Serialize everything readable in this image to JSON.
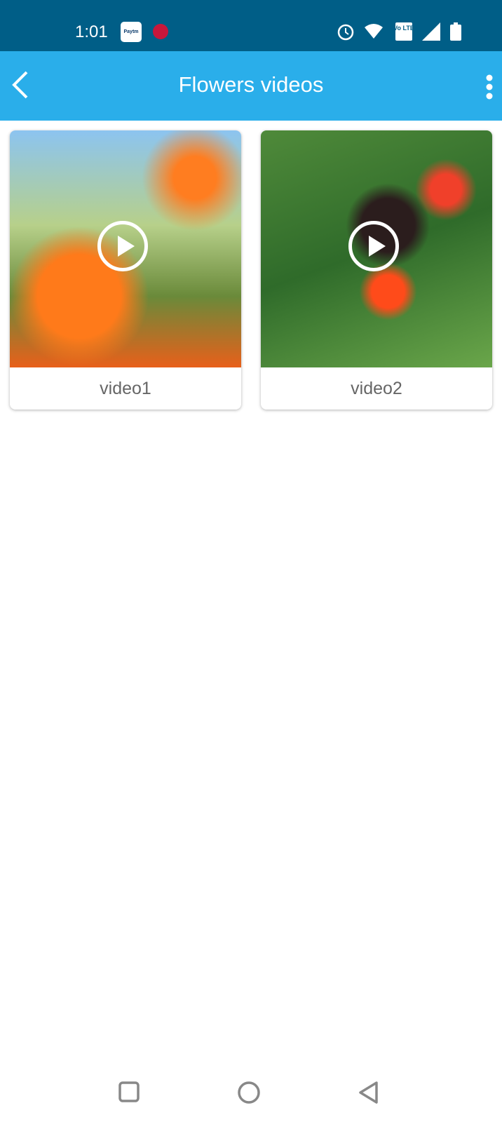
{
  "status_bar": {
    "time": "1:01",
    "paytm_label": "Paytm",
    "volte_label": "Vo LTE"
  },
  "app_bar": {
    "title": "Flowers videos"
  },
  "videos": [
    {
      "label": "video1"
    },
    {
      "label": "video2"
    }
  ],
  "colors": {
    "status_bar": "#005e87",
    "app_bar": "#2aaeea"
  }
}
